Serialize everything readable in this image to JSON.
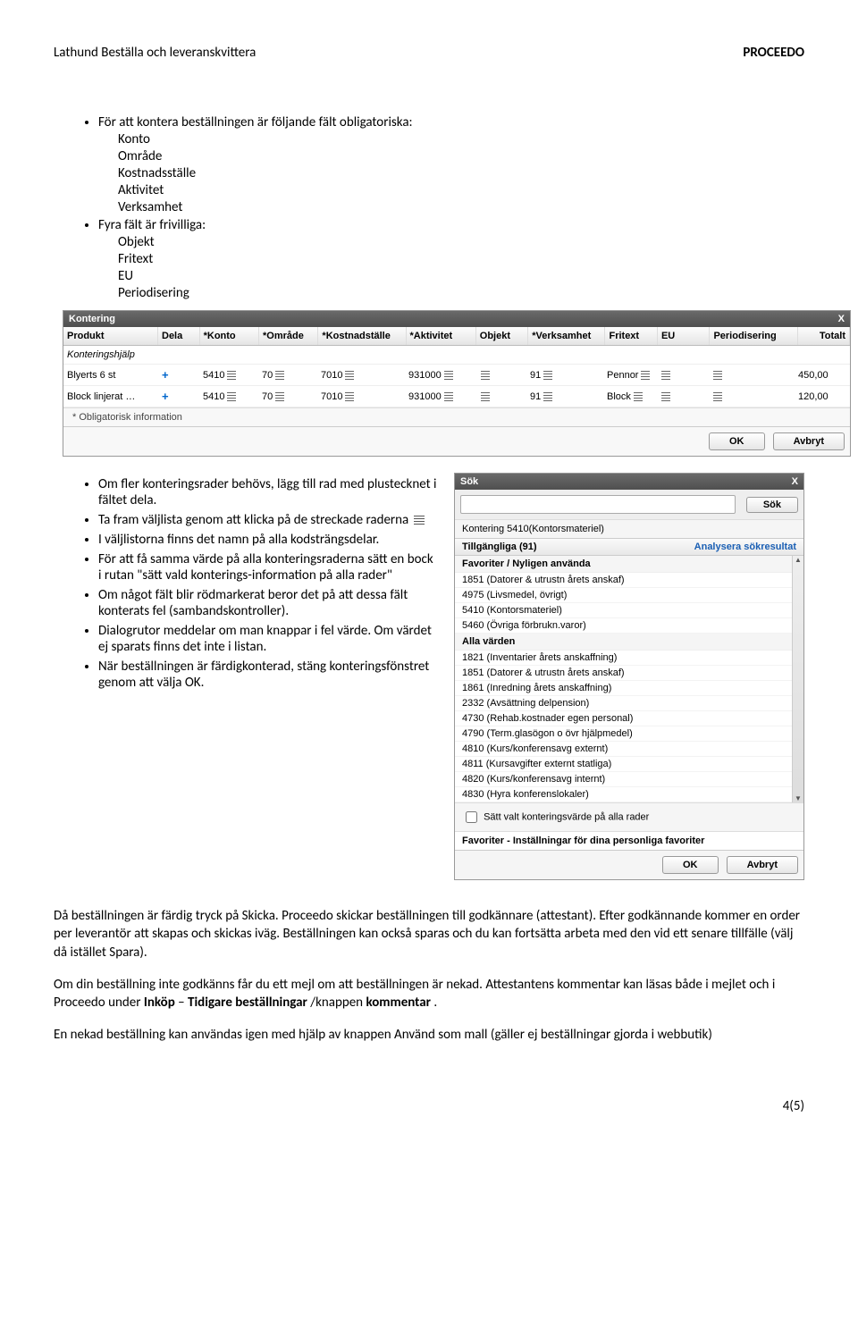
{
  "header": {
    "left": "Lathund Beställa och leveranskvittera",
    "right": "PROCEEDO"
  },
  "bullets1": {
    "intro": "För att kontera beställningen är följande fält obligatoriska:",
    "sub1": [
      "Konto",
      "Område",
      "Kostnadsställe",
      "Aktivitet",
      "Verksamhet"
    ],
    "intro2": "Fyra fält är frivilliga:",
    "sub2": [
      "Objekt",
      "Fritext",
      "EU",
      "Periodisering"
    ]
  },
  "kont": {
    "title": "Kontering",
    "cols": [
      "Produkt",
      "Dela",
      "*Konto",
      "*Område",
      "*Kostnadställe",
      "*Aktivitet",
      "Objekt",
      "*Verksamhet",
      "Fritext",
      "EU",
      "Periodisering",
      "Totalt"
    ],
    "helpRow": "Konteringshjälp",
    "row1": {
      "prod": "Blyerts 6 st",
      "konto": "5410",
      "omr": "70",
      "kost": "7010",
      "akt": "931000",
      "obj": "",
      "verk": "91",
      "fri": "Pennor",
      "eu": "",
      "per": "",
      "tot": "450,00"
    },
    "row2": {
      "prod": "Block linjerat …",
      "konto": "5410",
      "omr": "70",
      "kost": "7010",
      "akt": "931000",
      "obj": "",
      "verk": "91",
      "fri": "Block",
      "eu": "",
      "per": "",
      "tot": "120,00"
    },
    "note": "* Obligatorisk information",
    "ok": "OK",
    "cancel": "Avbryt"
  },
  "mid_bullets": {
    "b1": "Om fler konteringsrader behövs, lägg till rad med plustecknet i fältet dela.",
    "b2a": "Ta fram väljlista genom att klicka på de streckade raderna",
    "b3": "I väljlistorna finns det namn på alla kodsträngsdelar.",
    "b4": "För att få samma värde på alla konteringsraderna sätt en bock i rutan \"sätt vald konterings-information på alla rader\"",
    "b5": "Om något fält blir rödmarkerat beror det på att dessa fält konterats fel (sambandskontroller).",
    "b6": "Dialogrutor meddelar om man knappar i fel värde. Om värdet ej sparats finns det inte i listan.",
    "b7": "När beställningen är färdigkonterad, stäng konteringsfönstret  genom att välja OK."
  },
  "sok": {
    "title": "Sök",
    "searchBtn": "Sök",
    "kontering": "Kontering  5410(Kontorsmateriel)",
    "availLabel": "Tillgängliga (91)",
    "analysera": "Analysera sökresultat",
    "favHeader": "Favoriter / Nyligen använda",
    "favItems": [
      "1851 (Datorer & utrustn årets anskaf)",
      "4975 (Livsmedel, övrigt)",
      "5410 (Kontorsmateriel)",
      "5460 (Övriga förbrukn.varor)"
    ],
    "allaHeader": "Alla värden",
    "allaItems": [
      "1821 (Inventarier årets anskaffning)",
      "1851 (Datorer & utrustn årets anskaf)",
      "1861 (Inredning årets anskaffning)",
      "2332 (Avsättning delpension)",
      "4730 (Rehab.kostnader egen personal)",
      "4790 (Term.glasögon o övr hjälpmedel)",
      "4810 (Kurs/konferensavg externt)",
      "4811 (Kursavgifter externt statliga)",
      "4820 (Kurs/konferensavg internt)",
      "4830 (Hyra konferenslokaler)"
    ],
    "checkbox": "Sätt valt konteringsvärde på alla rader",
    "favLine": "Favoriter - Inställningar för dina personliga favoriter",
    "ok": "OK",
    "cancel": "Avbryt"
  },
  "paras": {
    "p1": "Då beställningen är färdig tryck på Skicka. Proceedo skickar beställningen till godkännare (attestant). Efter godkännande kommer en order per leverantör att skapas och skickas iväg. Beställningen kan också sparas och du kan fortsätta arbeta med den vid ett senare tillfälle (välj då istället Spara).",
    "p2a": "Om din beställning inte godkänns får du ett mejl om att beställningen är nekad. Attestantens kommentar kan läsas både i mejlet och i Proceedo under ",
    "p2b_bold": "Inköp",
    "p2_dash": " – ",
    "p2c_bold": "Tidigare beställningar",
    "p2d": "/knappen ",
    "p2e_bold": "kommentar",
    "p2f": ".",
    "p3": "En nekad beställning kan användas igen med hjälp av knappen  Använd som mall (gäller ej beställningar gjorda i webbutik)"
  },
  "footer": "4(5)"
}
